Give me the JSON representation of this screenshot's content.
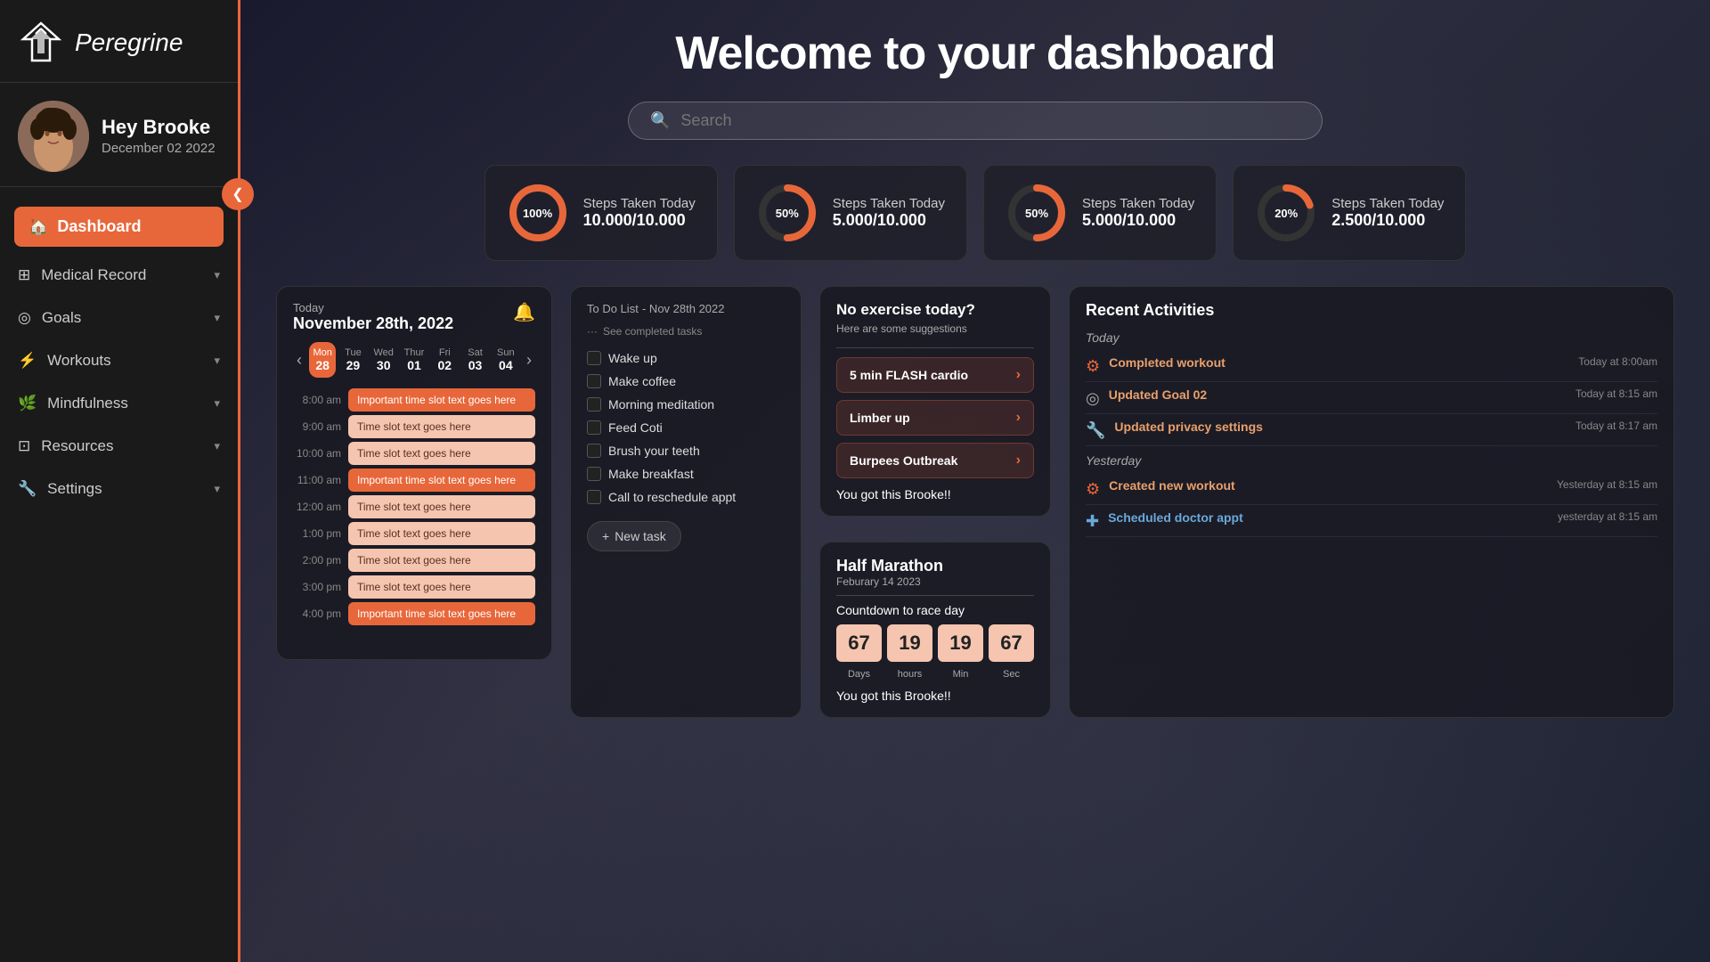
{
  "app": {
    "name": "Peregrine"
  },
  "sidebar": {
    "logo_alt": "Peregrine logo",
    "greeting": "Hey Brooke",
    "date": "December 02 2022",
    "nav": [
      {
        "id": "dashboard",
        "label": "Dashboard",
        "icon": "home",
        "active": true
      },
      {
        "id": "medical-record",
        "label": "Medical Record",
        "icon": "grid",
        "has_children": true
      },
      {
        "id": "goals",
        "label": "Goals",
        "icon": "target",
        "has_children": true
      },
      {
        "id": "workouts",
        "label": "Workouts",
        "icon": "dumbbell",
        "has_children": true
      },
      {
        "id": "mindfulness",
        "label": "Mindfulness",
        "icon": "leaf",
        "has_children": true
      },
      {
        "id": "resources",
        "label": "Resources",
        "icon": "book",
        "has_children": true
      },
      {
        "id": "settings",
        "label": "Settings",
        "icon": "wrench",
        "has_children": true
      }
    ]
  },
  "header": {
    "title": "Welcome to your dashboard",
    "search_placeholder": "Search"
  },
  "stats": [
    {
      "id": "stat1",
      "label": "Steps Taken Today",
      "value": "10.000/10.000",
      "percent": 100,
      "color": "#e8673a"
    },
    {
      "id": "stat2",
      "label": "Steps Taken Today",
      "value": "5.000/10.000",
      "percent": 50,
      "color": "#e8673a"
    },
    {
      "id": "stat3",
      "label": "Steps Taken Today",
      "value": "5.000/10.000",
      "percent": 50,
      "color": "#e8673a"
    },
    {
      "id": "stat4",
      "label": "Steps Taken Today",
      "value": "2.500/10.000",
      "percent": 20,
      "color": "#e8673a"
    }
  ],
  "calendar": {
    "today_label": "Today",
    "current_date": "November 28th, 2022",
    "days": [
      {
        "name": "Mon",
        "num": "28",
        "active": true
      },
      {
        "name": "Tue",
        "num": "29",
        "active": false
      },
      {
        "name": "Wed",
        "num": "30",
        "active": false
      },
      {
        "name": "Thur",
        "num": "01",
        "active": false
      },
      {
        "name": "Fri",
        "num": "02",
        "active": false
      },
      {
        "name": "Sat",
        "num": "03",
        "active": false
      },
      {
        "name": "Sun",
        "num": "04",
        "active": false
      }
    ],
    "time_slots": [
      {
        "time": "8:00 am",
        "text": "Important time slot text goes here",
        "important": true
      },
      {
        "time": "9:00 am",
        "text": "Time slot text goes here",
        "important": false
      },
      {
        "time": "10:00 am",
        "text": "Time slot text goes here",
        "important": false
      },
      {
        "time": "11:00 am",
        "text": "Important time slot text goes here",
        "important": true
      },
      {
        "time": "12:00 am",
        "text": "Time slot text goes here",
        "important": false
      },
      {
        "time": "1:00 pm",
        "text": "Time slot text goes here",
        "important": false
      },
      {
        "time": "2:00 pm",
        "text": "Time slot text goes here",
        "important": false
      },
      {
        "time": "3:00 pm",
        "text": "Time slot text goes here",
        "important": false
      },
      {
        "time": "4:00 pm",
        "text": "Important time slot text goes here",
        "important": true
      }
    ]
  },
  "todo": {
    "title": "To Do List",
    "date": "Nov 28th 2022",
    "see_completed": "See completed tasks",
    "items": [
      {
        "text": "Wake up",
        "done": false
      },
      {
        "text": "Make coffee",
        "done": false
      },
      {
        "text": "Morning meditation",
        "done": false
      },
      {
        "text": "Feed Coti",
        "done": false
      },
      {
        "text": "Brush your teeth",
        "done": false
      },
      {
        "text": "Make breakfast",
        "done": false
      },
      {
        "text": "Call to reschedule appt",
        "done": false
      }
    ],
    "new_task_label": "+ New task"
  },
  "exercise": {
    "title": "No exercise today?",
    "subtitle": "Here are some suggestions",
    "suggestions": [
      {
        "label": "5 min FLASH cardio"
      },
      {
        "label": "Limber up"
      },
      {
        "label": "Burpees Outbreak"
      }
    ],
    "encouragement": "You got this Brooke!!"
  },
  "marathon": {
    "title": "Half Marathon",
    "date": "Feburary 14 2023",
    "countdown_label": "Countdown to race day",
    "days": "67",
    "hours": "19",
    "min": "19",
    "sec": "67",
    "units": [
      "Days",
      "hours",
      "Min",
      "Sec"
    ],
    "encouragement": "You got this Brooke!!"
  },
  "activities": {
    "title": "Recent Activities",
    "today_label": "Today",
    "yesterday_label": "Yesterday",
    "items": [
      {
        "type": "workout",
        "text": "Completed workout",
        "time": "Today at 8:00am",
        "day": "today"
      },
      {
        "type": "goal",
        "text": "Updated Goal 02",
        "time": "Today at 8:15 am",
        "day": "today"
      },
      {
        "type": "settings",
        "text": "Updated privacy settings",
        "time": "Today at 8:17 am",
        "day": "today"
      },
      {
        "type": "workout",
        "text": "Created new workout",
        "time": "Yesterday at 8:15 am",
        "day": "yesterday"
      },
      {
        "type": "medical",
        "text": "Scheduled doctor appt",
        "time": "yesterday at 8:15 am",
        "day": "yesterday"
      }
    ]
  }
}
